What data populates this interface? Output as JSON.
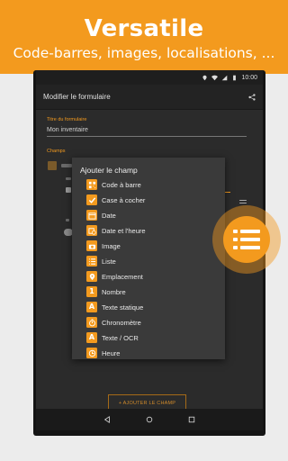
{
  "banner": {
    "title": "Versatile",
    "subtitle": "Code-barres, images, localisations, ..."
  },
  "status_bar": {
    "time": "10:00"
  },
  "app_bar": {
    "title": "Modifier le formulaire"
  },
  "form": {
    "title_label": "Titre du formulaire",
    "title_value": "Mon inventaire",
    "fields_label": "Champs",
    "add_field_button": "+ AJOUTER LE CHAMP"
  },
  "dialog": {
    "title": "Ajouter le champ",
    "items": [
      {
        "label": "Code à barre",
        "icon": "barcode-icon"
      },
      {
        "label": "Case à cocher",
        "icon": "checkbox-icon"
      },
      {
        "label": "Date",
        "icon": "calendar-icon"
      },
      {
        "label": "Date et l'heure",
        "icon": "calendar-clock-icon"
      },
      {
        "label": "Image",
        "icon": "camera-icon"
      },
      {
        "label": "Liste",
        "icon": "list-icon"
      },
      {
        "label": "Emplacement",
        "icon": "location-pin-icon"
      },
      {
        "label": "Nombre",
        "icon": "number-icon"
      },
      {
        "label": "Texte statique",
        "icon": "static-text-icon"
      },
      {
        "label": "Chronomètre",
        "icon": "stopwatch-icon"
      },
      {
        "label": "Texte / OCR",
        "icon": "ocr-text-icon"
      },
      {
        "label": "Heure",
        "icon": "clock-icon"
      }
    ]
  },
  "colors": {
    "accent": "#f39a1e",
    "background": "#2b2b2b",
    "dialog": "#3a3a3a"
  }
}
